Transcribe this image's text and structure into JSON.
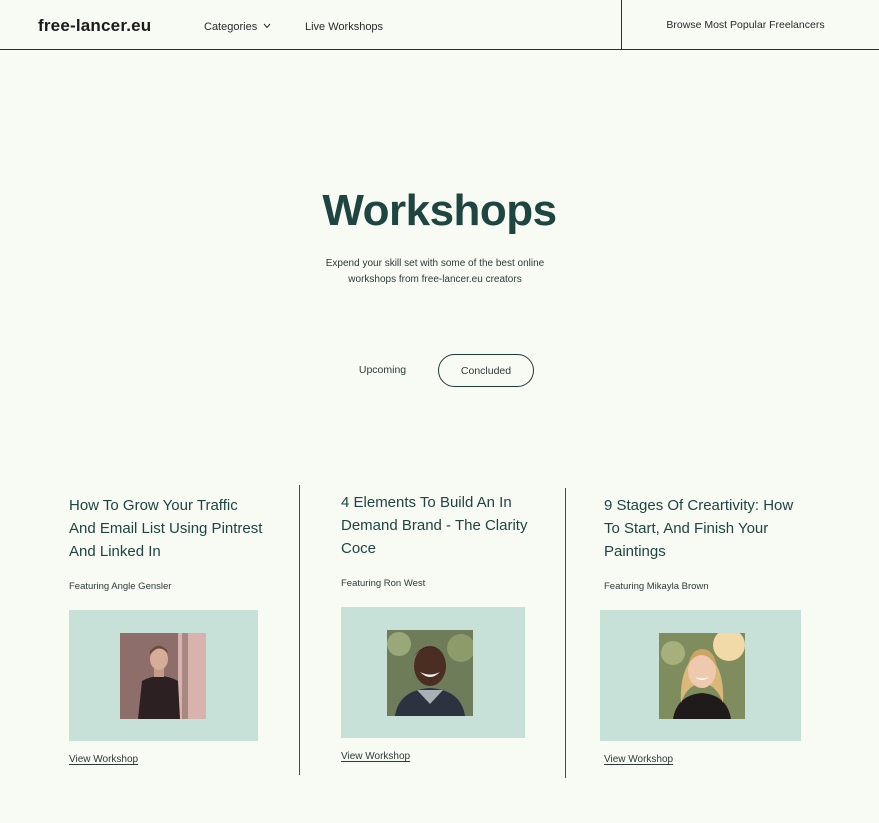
{
  "header": {
    "logo": "free-lancer.eu",
    "nav": {
      "categories": "Categories",
      "live_workshops": "Live Workshops"
    },
    "browse": "Browse Most Popular Freelancers"
  },
  "hero": {
    "title": "Workshops",
    "subtitle_line1": "Expend your skill set with some of the best online",
    "subtitle_line2": "workshops from free-lancer.eu creators"
  },
  "tabs": {
    "upcoming": "Upcoming",
    "concluded": "Concluded",
    "active": "Concluded"
  },
  "workshops": [
    {
      "title_lines": [
        "How To Grow Your Traffic",
        "And Email List Using Pintrest",
        "And Linked In"
      ],
      "featuring": "Featuring Angle Gensler",
      "link": "View Workshop"
    },
    {
      "title_lines": [
        "4 Elements To Build An In",
        "Demand Brand - The Clarity",
        "Coce"
      ],
      "featuring": "Featuring Ron West",
      "link": "View Workshop"
    },
    {
      "title_lines": [
        "9 Stages Of Creartivity: How",
        "To Start, And Finish Your",
        "Paintings"
      ],
      "featuring": "Featuring Mikayla Brown",
      "link": "View Workshop"
    }
  ],
  "colors": {
    "background": "#f8faf4",
    "accent_dark_green": "#1f4540",
    "image_bg_mint": "#c8e1d8"
  }
}
